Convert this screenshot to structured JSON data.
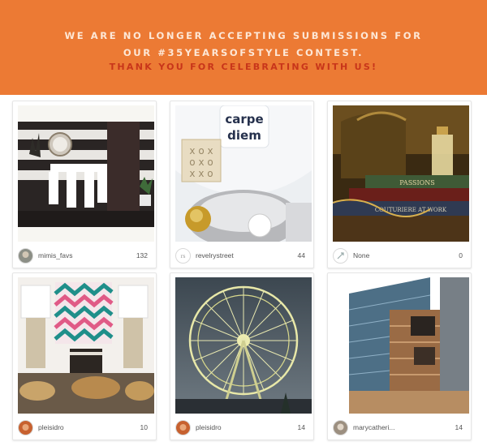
{
  "banner": {
    "line1": "WE ARE NO LONGER ACCEPTING SUBMISSIONS FOR",
    "line2": "OUR #35YEARSOFSTYLE CONTEST.",
    "line3": "THANK YOU FOR CELEBRATING WITH US!",
    "colors": {
      "background": "#ec7a34",
      "text": "#fde7d6",
      "accent": "#c8351a"
    }
  },
  "cards": [
    {
      "username": "mimis_favs",
      "count": "132",
      "photo": "dining-room-photo"
    },
    {
      "username": "revelrystreet",
      "count": "44",
      "photo": "carpe-diem-pillow-photo"
    },
    {
      "username": "None",
      "count": "0",
      "photo": "handbag-perfume-books-photo"
    },
    {
      "username": "pleisidro",
      "count": "10",
      "photo": "chevron-art-lamps-photo"
    },
    {
      "username": "pleisidro",
      "count": "14",
      "photo": "ferris-wheel-photo"
    },
    {
      "username": "marycatheri...",
      "count": "14",
      "photo": "modern-building-photo"
    }
  ],
  "photo_text": {
    "pillow": [
      "carpe",
      "diem"
    ],
    "books": [
      "PASSIONS",
      "COUTURIERE AT WORK"
    ]
  }
}
